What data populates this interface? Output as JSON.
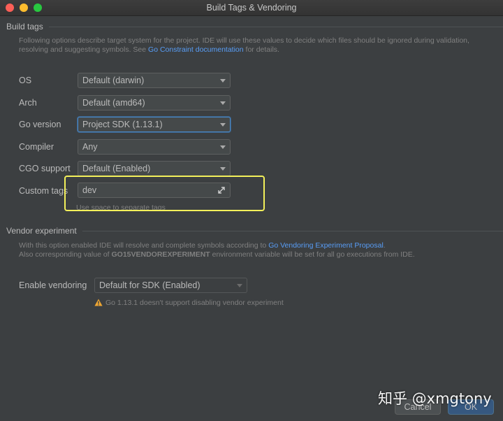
{
  "window": {
    "title": "Build Tags & Vendoring"
  },
  "build_tags": {
    "section_title": "Build tags",
    "description_line1": "Following options describe target system for the project. IDE will use these values to decide which files should be ignored during validation,",
    "description_line2_prefix": "resolving and suggesting symbols. See ",
    "description_link": "Go Constraint documentation",
    "description_line2_suffix": " for details.",
    "fields": {
      "os": {
        "label": "OS",
        "value": "Default (darwin)"
      },
      "arch": {
        "label": "Arch",
        "value": "Default (amd64)"
      },
      "go_version": {
        "label": "Go version",
        "value": "Project SDK (1.13.1)"
      },
      "compiler": {
        "label": "Compiler",
        "value": "Any"
      },
      "cgo_support": {
        "label": "CGO support",
        "value": "Default (Enabled)"
      },
      "custom_tags": {
        "label": "Custom tags",
        "value": "dev",
        "hint": "Use space to separate tags",
        "icon": "expand-icon"
      }
    }
  },
  "vendor": {
    "section_title": "Vendor experiment",
    "description_line1_prefix": "With this option enabled IDE will resolve and complete symbols according to ",
    "description_link": "Go Vendoring Experiment Proposal",
    "description_line1_suffix": ".",
    "description_line2_prefix": "Also corresponding value of ",
    "description_env": "GO15VENDOREXPERIMENT",
    "description_line2_suffix": " environment variable will be set for all go executions from IDE.",
    "enable_label": "Enable vendoring",
    "enable_value": "Default for SDK (Enabled)",
    "warning": "Go 1.13.1 doesn't support disabling vendor experiment",
    "warning_icon": "warning-icon"
  },
  "buttons": {
    "cancel": "Cancel",
    "ok": "OK"
  },
  "watermark": "知乎 @xmgtony",
  "colors": {
    "background": "#3c3f41",
    "link": "#589df6",
    "highlight": "#f3f05a",
    "ok_button": "#365880",
    "focus": "#4a88c7"
  }
}
